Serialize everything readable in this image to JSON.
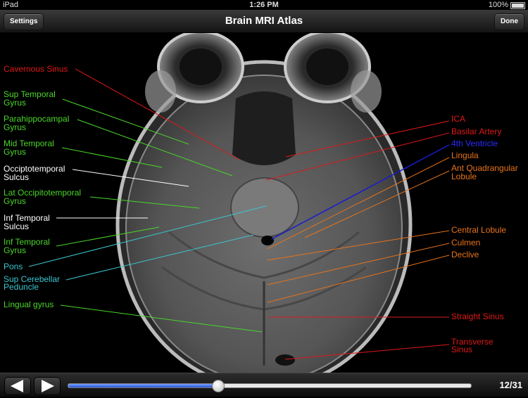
{
  "status_bar": {
    "carrier": "iPad",
    "time": "1:26 PM",
    "battery": "100%"
  },
  "nav": {
    "title": "Brain MRI Atlas",
    "settings_label": "Settings",
    "done_label": "Done"
  },
  "labels": {
    "cavernous_sinus": "Cavernous Sinus",
    "sup_temporal_1": "Sup Temporal",
    "sup_temporal_2": "Gyrus",
    "parahippocampal_1": "Parahippocampal",
    "parahippocampal_2": "Gyrus",
    "mid_temporal_1": "Mid Temporal",
    "mid_temporal_2": "Gyrus",
    "occipitotemporal_1": "Occiptotemporal",
    "occipitotemporal_2": "Sulcus",
    "lat_occipitotemporal_1": "Lat Occipitotemporal",
    "lat_occipitotemporal_2": "Gyrus",
    "inf_temporal_sulcus_1": "Inf Temporal",
    "inf_temporal_sulcus_2": "Sulcus",
    "inf_temporal_gyrus_1": "Inf Temporal",
    "inf_temporal_gyrus_2": "Gyrus",
    "pons": "Pons",
    "sup_cerebellar_1": "Sup Cerebellar",
    "sup_cerebellar_2": "Peduncle",
    "lingual_gyrus": "Lingual gyrus",
    "ica": "ICA",
    "basilar_artery": "Basilar Artery",
    "fourth_ventricle": "4th Ventricle",
    "lingula": "Lingula",
    "ant_quadrangular_1": "Ant Quadrangular",
    "ant_quadrangular_2": "Lobule",
    "central_lobule": "Central Lobule",
    "culmen": "Culmen",
    "declive": "Declive",
    "straight_sinus": "Straight Sinus",
    "transverse_sinus_1": "Transverse",
    "transverse_sinus_2": "Sinus"
  },
  "colors": {
    "red": "#e01818",
    "green": "#4ad62a",
    "white": "#ffffff",
    "cyan": "#39c6cf",
    "blue": "#1a1ad0",
    "orange": "#e8741c"
  },
  "toolbar": {
    "page": "12/31",
    "slider_fraction": 0.37
  }
}
